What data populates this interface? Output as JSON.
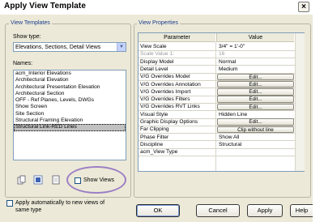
{
  "dialog": {
    "title": "Apply View Template",
    "close_glyph": "×"
  },
  "view_templates": {
    "group_label": "View Templates",
    "show_type_label": "Show type:",
    "show_type_value": "Elevations, Sections, Detail Views",
    "names_label": "Names:",
    "names": [
      "acm_Interior Elevations",
      "Architectural Elevation",
      "Architectural Presentation Elevation",
      "Architectural Section",
      "OFF - Ref Planes, Levels, DWGs",
      "Show Screen",
      "Site Section",
      "Structural Framing Elevation",
      "Structural Link-RED Lines"
    ],
    "selected_index": 8,
    "show_views_label": "Show Views",
    "show_views_checked": false
  },
  "apply_automatically": {
    "label_line1": "Apply automatically to new views of",
    "label_line2": "same type",
    "checked": false
  },
  "view_properties": {
    "group_label": "View Properties",
    "columns": [
      "Parameter",
      "Value"
    ],
    "rows": [
      {
        "param": "View Scale",
        "value": "3/4\" = 1'-0\"",
        "kind": "text"
      },
      {
        "param": "Scale Value    1:",
        "value": "16",
        "kind": "grey"
      },
      {
        "param": "Display Model",
        "value": "Normal",
        "kind": "text"
      },
      {
        "param": "Detail Level",
        "value": "Medium",
        "kind": "text"
      },
      {
        "param": "V/G Overrides Model",
        "value": "Edit...",
        "kind": "button"
      },
      {
        "param": "V/G Overrides Annotation",
        "value": "Edit...",
        "kind": "button"
      },
      {
        "param": "V/G Overrides Import",
        "value": "Edit...",
        "kind": "button"
      },
      {
        "param": "V/G Overrides Filters",
        "value": "Edit...",
        "kind": "button"
      },
      {
        "param": "V/G Overrides RVT Links",
        "value": "Edit...",
        "kind": "button"
      },
      {
        "param": "Visual Style",
        "value": "Hidden Line",
        "kind": "text"
      },
      {
        "param": "Graphic Display Options",
        "value": "Edit...",
        "kind": "button"
      },
      {
        "param": "Far Clipping",
        "value": "Clip without line",
        "kind": "button"
      },
      {
        "param": "Phase Filter",
        "value": "Show All",
        "kind": "text"
      },
      {
        "param": "Discipline",
        "value": "Structural",
        "kind": "text"
      },
      {
        "param": "acm_View Type",
        "value": "",
        "kind": "text"
      }
    ]
  },
  "buttons": {
    "ok": "OK",
    "cancel": "Cancel",
    "apply": "Apply",
    "help": "Help"
  },
  "colors": {
    "dialog_bg": "#ece9d8",
    "group_label": "#1a3c8c",
    "highlight_ring": "#9c7fc4",
    "selected_row": "#c1c1c1"
  }
}
